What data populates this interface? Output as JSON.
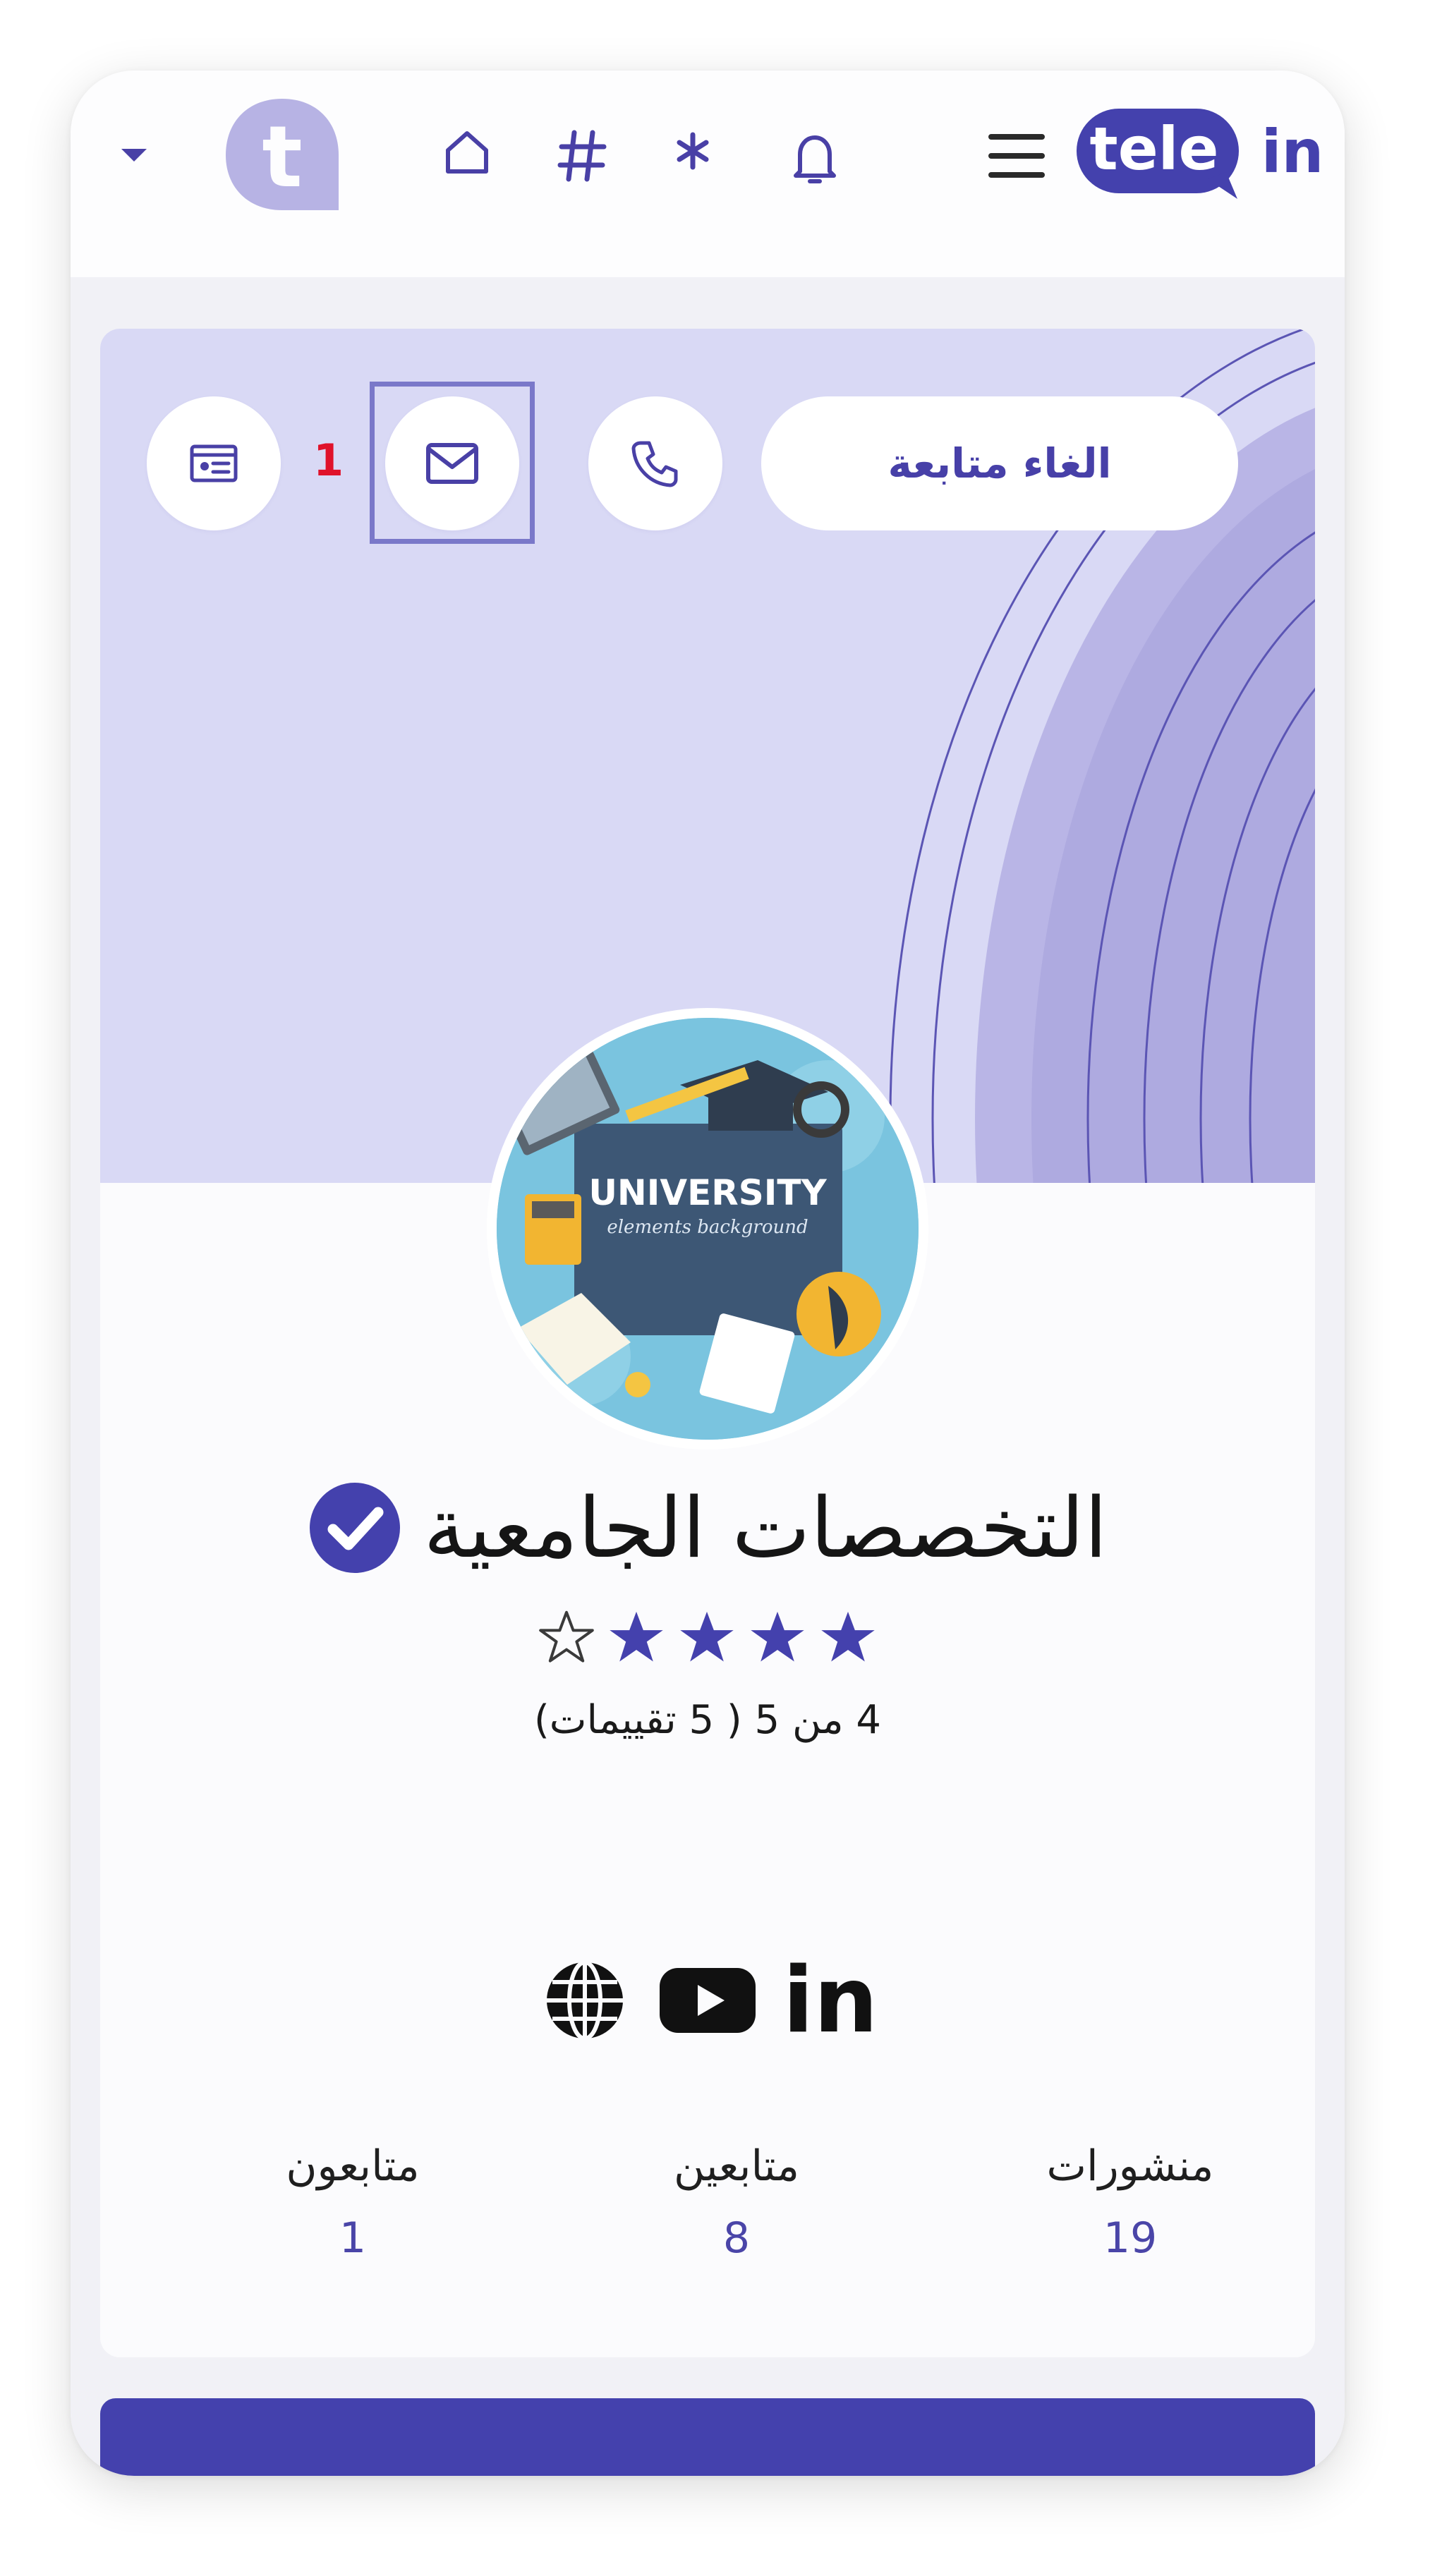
{
  "app": {
    "logo_part1": "tele",
    "logo_part2": "in",
    "avatar_letter": "t"
  },
  "nav": {
    "icons": [
      "dropdown-caret-icon",
      "home-icon",
      "hashtag-icon",
      "asterisk-icon",
      "bell-icon",
      "menu-icon"
    ]
  },
  "profile": {
    "unfollow_label": "الغاء متابعة",
    "annotation_number": "1",
    "cover_image_text_1": "UNIVERSITY",
    "cover_image_text_2": "elements background",
    "name": "التخصصات الجامعية",
    "rating": 4,
    "rating_max": 5,
    "rating_text": "4 من 5 ( 5 تقييمات)"
  },
  "social": {
    "icons": [
      "globe-icon",
      "youtube-icon",
      "linkedin-icon"
    ],
    "linkedin_text": "in"
  },
  "stats": {
    "posts_label": "منشورات",
    "posts_value": "19",
    "followers_label": "متابعين",
    "followers_value": "8",
    "following_label": "متابعون",
    "following_value": "1"
  },
  "colors": {
    "accent": "#4441ad",
    "cover_bg": "#d9d9f5",
    "cover_wave": "#aeaae0",
    "annotation": "#e0122a",
    "star_filled": "#4441ad"
  }
}
